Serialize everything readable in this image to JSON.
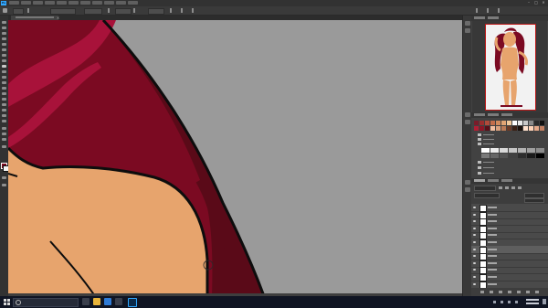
{
  "app": {
    "name": "Adobe Photoshop",
    "logo_text": "Ps"
  },
  "menubar": {
    "items": [
      {
        "key": "file",
        "label": ""
      },
      {
        "key": "edit",
        "label": ""
      },
      {
        "key": "image",
        "label": ""
      },
      {
        "key": "layer",
        "label": ""
      },
      {
        "key": "type",
        "label": ""
      },
      {
        "key": "select",
        "label": ""
      },
      {
        "key": "filter",
        "label": ""
      },
      {
        "key": "3d",
        "label": ""
      },
      {
        "key": "view",
        "label": ""
      },
      {
        "key": "window",
        "label": ""
      },
      {
        "key": "help",
        "label": ""
      }
    ],
    "window_controls": {
      "minimize": "–",
      "maximize": "□",
      "close": "✕"
    }
  },
  "options_bar": {
    "active_tool_icon": "brush-icon",
    "brush_size": "",
    "mode_label": "",
    "mode_value": "",
    "opacity_label": "",
    "opacity_value": "",
    "flow_label": "",
    "flow_value": "",
    "smoothing_label": "",
    "smoothing_value": ""
  },
  "document_tab": {
    "title": "",
    "close": "×"
  },
  "panels": {
    "navigator": {
      "tabs": [
        "",
        ""
      ]
    },
    "swatches": {
      "tabs": [
        "",
        "",
        ""
      ],
      "rows": [
        [
          "#7a1c2a",
          "#9a2e2e",
          "#b04a3a",
          "#c26d4a",
          "#d18a5c",
          "#e0a574",
          "#f0c89a",
          "#ffffff",
          "#e8e8e8",
          "#c8c8c8",
          "#8a8a8a",
          "#2a2a2a",
          "#111111"
        ],
        [
          "#b21e34",
          "#8e1526",
          "#5c0e18",
          "#f3bfa0",
          "#d9a07d",
          "#b97a56",
          "#6a3a26",
          "#3a2015",
          "#1a0f0a",
          "#ffe0cc",
          "#ffd3b8",
          "#e6a98a",
          "#c28062"
        ]
      ],
      "greys": [
        "#ffffff",
        "#ececec",
        "#d9d9d9",
        "#c6c6c6",
        "#b3b3b3",
        "#a0a0a0",
        "#8c8c8c",
        "#797979",
        "#666666",
        "#535353",
        "#404040",
        "#2d2d2d",
        "#1a1a1a",
        "#000000"
      ],
      "groups": [
        "",
        "",
        "",
        "",
        "",
        ""
      ]
    },
    "layers": {
      "tabs": [
        "",
        "",
        ""
      ],
      "filter_kind": "",
      "blend_mode": "",
      "opacity": "",
      "fill": "",
      "rows": [
        {
          "name": "",
          "selected": false
        },
        {
          "name": "",
          "selected": false
        },
        {
          "name": "",
          "selected": false
        },
        {
          "name": "",
          "selected": false
        },
        {
          "name": "",
          "selected": false
        },
        {
          "name": "",
          "selected": false
        },
        {
          "name": "",
          "selected": true
        },
        {
          "name": "",
          "selected": false
        },
        {
          "name": "",
          "selected": false
        },
        {
          "name": "",
          "selected": false
        },
        {
          "name": "",
          "selected": false
        },
        {
          "name": "",
          "selected": false
        }
      ]
    }
  },
  "canvas": {
    "colors": {
      "background": "#9a9a9a",
      "hair_dark": "#5a0a18",
      "hair_main": "#7b0a22",
      "hair_highlight": "#a8123a",
      "skin": "#e7a46d",
      "outline": "#0d0d0d"
    }
  },
  "tool_colors": {
    "foreground": "#7a0a1e",
    "background": "#f4f4f4"
  },
  "taskbar": {
    "search_placeholder": "",
    "apps": [
      "file-explorer-icon",
      "edge-icon",
      "store-icon",
      "photoshop-icon"
    ],
    "time": "",
    "date": ""
  }
}
